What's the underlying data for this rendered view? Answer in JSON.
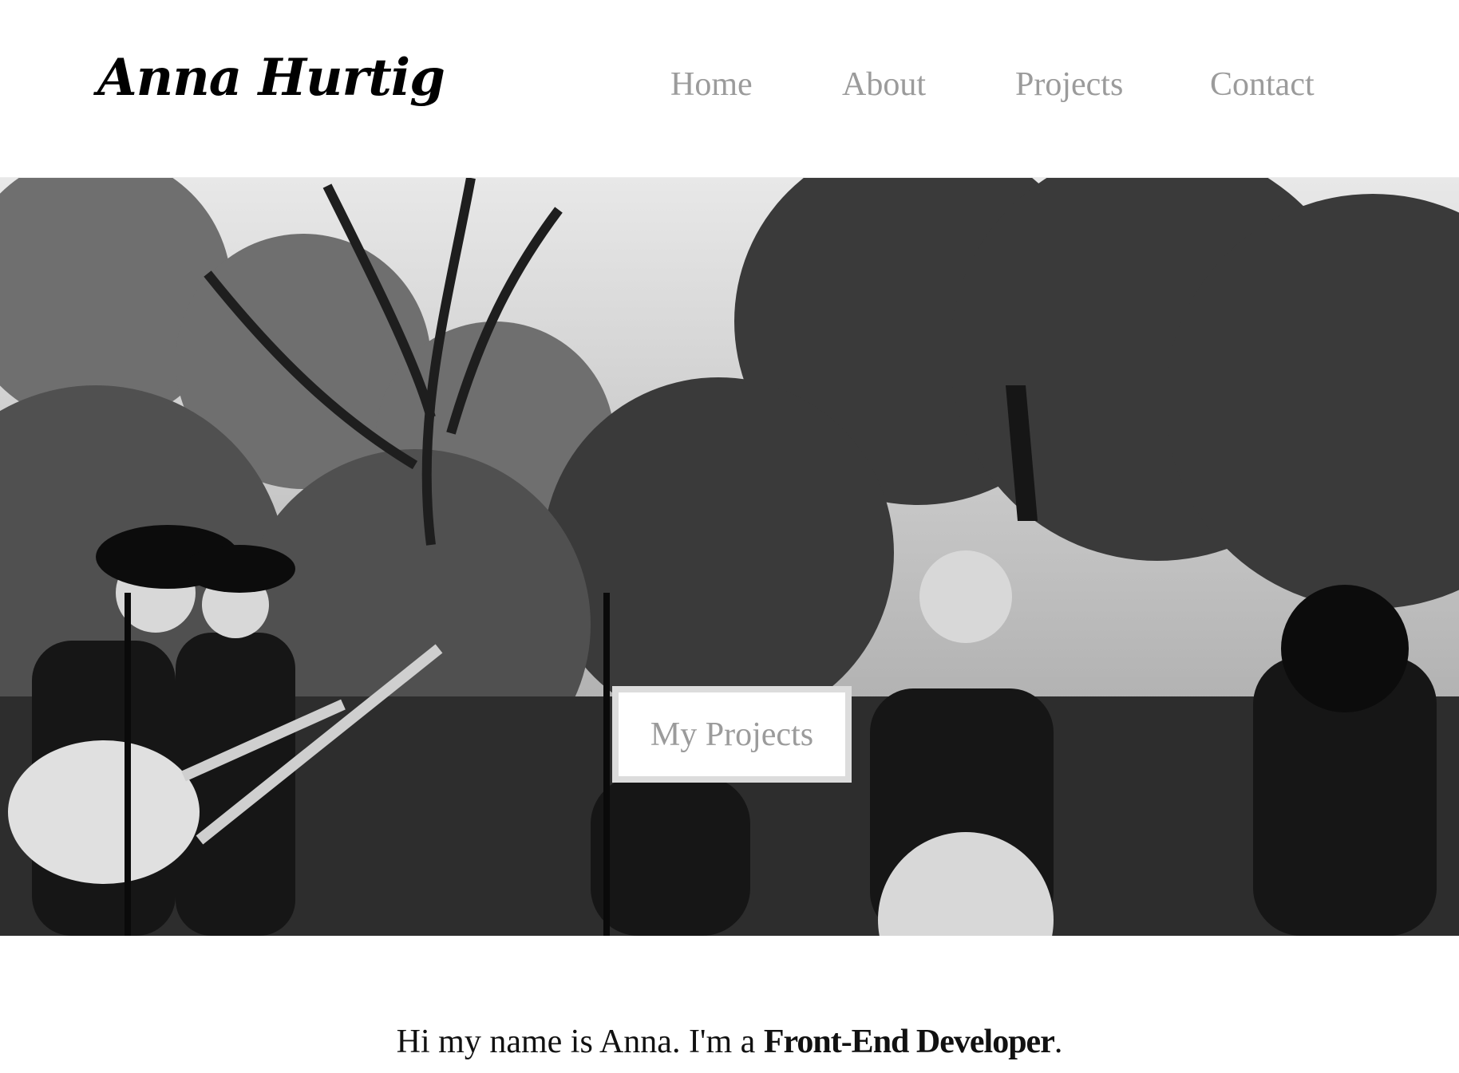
{
  "brand": {
    "name": "Anna Hurtig"
  },
  "nav": {
    "home": "Home",
    "about": "About",
    "projects": "Projects",
    "contact": "Contact"
  },
  "hero": {
    "button_label": "My Projects",
    "photo": "black-and-white band performing outdoors under trees"
  },
  "intro": {
    "before": "Hi my name is Anna. I'm a ",
    "role": "Front-End Developer",
    "after": "."
  },
  "colors": {
    "nav_text": "#9b9b9b",
    "button_border": "#dcdcdc",
    "text": "#111111"
  }
}
